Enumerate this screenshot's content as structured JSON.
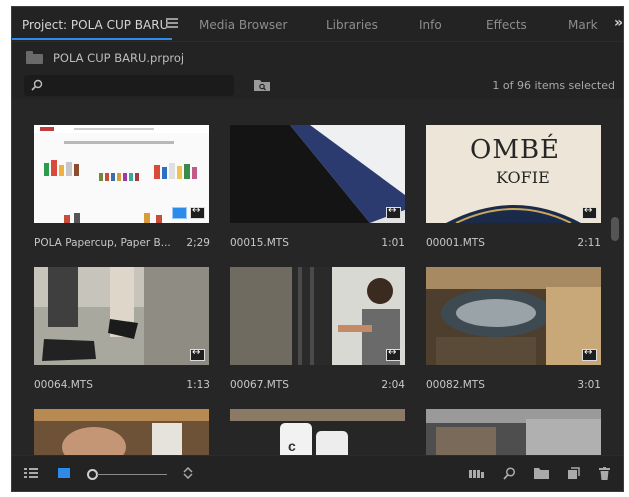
{
  "tabs": [
    {
      "label": "Project: POLA CUP BARU"
    },
    {
      "label": "Media Browser"
    },
    {
      "label": "Libraries"
    },
    {
      "label": "Info"
    },
    {
      "label": "Effects"
    },
    {
      "label": "Mark"
    }
  ],
  "project_file": "POLA CUP BARU.prproj",
  "search": {
    "value": "",
    "placeholder": ""
  },
  "selection_count": "1 of 96 items selected",
  "clips": [
    {
      "name": "POLA Papercup, Paper B...",
      "duration": "2;29"
    },
    {
      "name": "00015.MTS",
      "duration": "1:01"
    },
    {
      "name": "00001.MTS",
      "duration": "2:11"
    },
    {
      "name": "00064.MTS",
      "duration": "1:13"
    },
    {
      "name": "00067.MTS",
      "duration": "2:04"
    },
    {
      "name": "00082.MTS",
      "duration": "3:01"
    },
    {
      "name": "",
      "duration": ""
    },
    {
      "name": "",
      "duration": ""
    },
    {
      "name": "",
      "duration": ""
    }
  ],
  "thumb_text": {
    "ombe_line1": "OMBÉ",
    "ombe_line2": "KOFIE"
  },
  "colors": {
    "accent": "#2d8ceb",
    "panel": "#232323",
    "grid": "#262626"
  }
}
